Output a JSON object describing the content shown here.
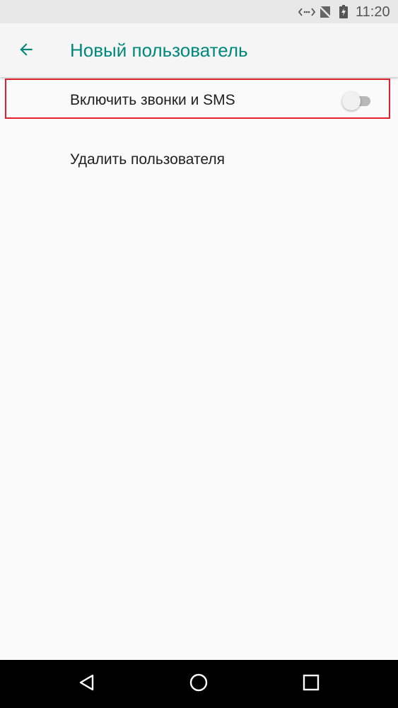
{
  "status_bar": {
    "time": "11:20",
    "icons": [
      "data-transfer-icon",
      "no-signal-icon",
      "battery-charging-icon"
    ]
  },
  "toolbar": {
    "back_icon": "arrow-left-icon",
    "title": "Новый пользователь"
  },
  "settings": {
    "items": [
      {
        "label": "Включить звонки и SMS",
        "toggle": {
          "checked": false
        }
      },
      {
        "label": "Удалить пользователя"
      }
    ]
  },
  "nav_bar": {
    "icons": [
      "nav-back-icon",
      "nav-home-icon",
      "nav-recents-icon"
    ]
  },
  "colors": {
    "accent": "#00897b",
    "highlight": "#e0202a",
    "background": "#fafafa",
    "status_bar": "#e8e8e8",
    "nav_bar": "#000000"
  }
}
